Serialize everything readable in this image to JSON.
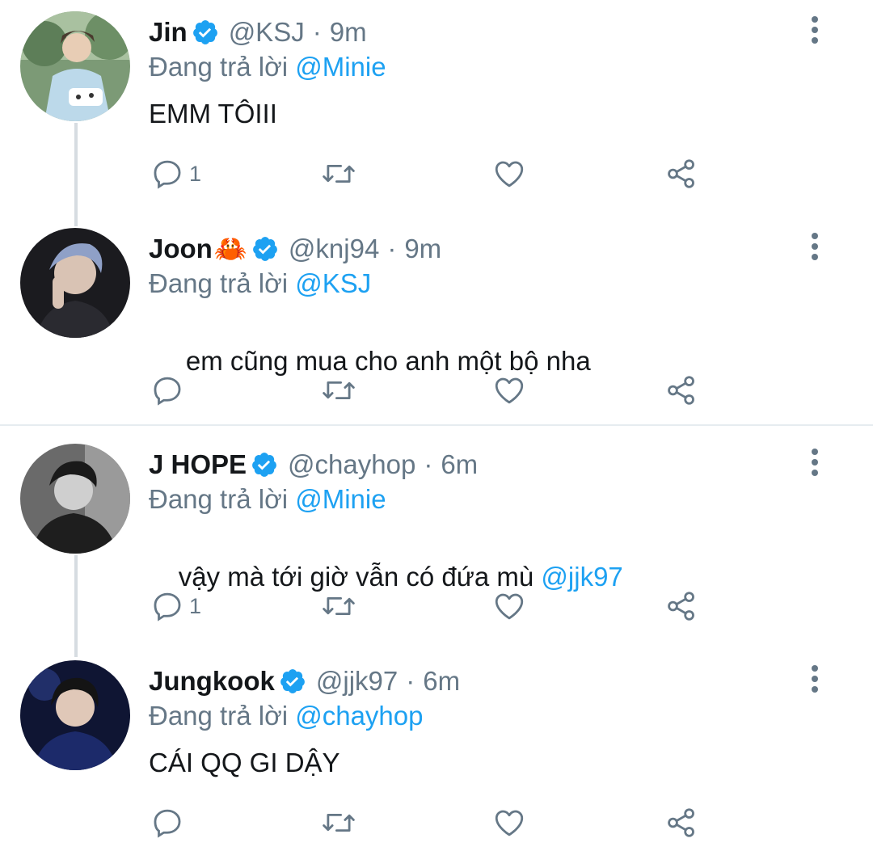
{
  "colors": {
    "accent": "#1da1f2",
    "secondary_text": "#657786",
    "primary_text": "#14171a",
    "thread_line": "#d6dce1"
  },
  "icons": {
    "reply": "reply-icon",
    "retweet": "retweet-icon",
    "like": "like-icon",
    "share": "share-icon",
    "more": "more-vertical-icon",
    "verified": "verified-badge-icon"
  },
  "tweets": [
    {
      "name": "Jin",
      "emoji": "",
      "handle": "@KSJ",
      "separator": "·",
      "time": "9m",
      "replying_prefix": "Đang trả lời",
      "replying_to": "@Minie",
      "text": "EMM TÔIII",
      "text_mention": "",
      "reply_count": "1"
    },
    {
      "name": "Joon",
      "emoji": "🦀",
      "handle": "@knj94",
      "separator": "·",
      "time": "9m",
      "replying_prefix": "Đang trả lời",
      "replying_to": "@KSJ",
      "text": " em cũng mua cho anh một bộ nha",
      "text_mention": "",
      "reply_count": ""
    },
    {
      "name": "J HOPE",
      "emoji": "",
      "handle": "@chayhop",
      "separator": "·",
      "time": "6m",
      "replying_prefix": "Đang trả lời",
      "replying_to": "@Minie",
      "text": "vậy mà tới giờ vẫn có đứa mù ",
      "text_mention": "@jjk97",
      "reply_count": "1"
    },
    {
      "name": "Jungkook",
      "emoji": "",
      "handle": "@jjk97",
      "separator": "·",
      "time": "6m",
      "replying_prefix": "Đang trả lời",
      "replying_to": "@chayhop",
      "text": "CÁI QQ GI DẬY",
      "text_mention": "",
      "reply_count": ""
    }
  ]
}
